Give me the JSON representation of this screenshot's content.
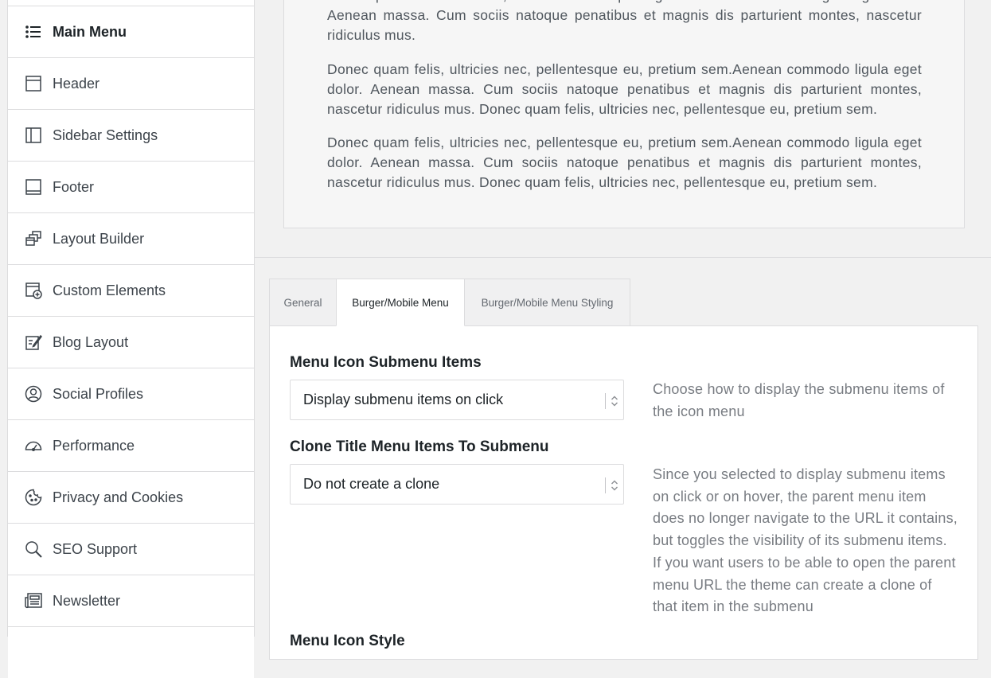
{
  "sidebar": {
    "items": [
      {
        "label": "Main Menu",
        "icon": "list-icon",
        "active": true
      },
      {
        "label": "Header",
        "icon": "header-layout-icon"
      },
      {
        "label": "Sidebar Settings",
        "icon": "sidebar-layout-icon"
      },
      {
        "label": "Footer",
        "icon": "footer-layout-icon"
      },
      {
        "label": "Layout Builder",
        "icon": "layers-icon"
      },
      {
        "label": "Custom Elements",
        "icon": "add-element-icon"
      },
      {
        "label": "Blog Layout",
        "icon": "edit-icon"
      },
      {
        "label": "Social Profiles",
        "icon": "user-circle-icon"
      },
      {
        "label": "Performance",
        "icon": "gauge-icon"
      },
      {
        "label": "Privacy and Cookies",
        "icon": "cookie-icon"
      },
      {
        "label": "SEO Support",
        "icon": "search-icon"
      },
      {
        "label": "Newsletter",
        "icon": "newspaper-icon"
      }
    ]
  },
  "preview": {
    "paragraphs": [
      "Lorem ipsum dolor sit amet, consectetuer adipiscing elit. Aenean commodo ligula eget dolor. Aenean massa. Cum sociis natoque penatibus et magnis dis parturient montes, nascetur ridiculus mus.",
      "Donec quam felis, ultricies nec, pellentesque eu, pretium sem.Aenean commodo ligula eget dolor. Aenean massa. Cum sociis natoque penatibus et magnis dis parturient montes, nascetur ridiculus mus. Donec quam felis, ultricies nec, pellentesque eu, pretium sem.",
      "Donec quam felis, ultricies nec, pellentesque eu, pretium sem.Aenean commodo ligula eget dolor. Aenean massa. Cum sociis natoque penatibus et magnis dis parturient montes, nascetur ridiculus mus. Donec quam felis, ultricies nec, pellentesque eu, pretium sem."
    ]
  },
  "tabs": [
    {
      "label": "General"
    },
    {
      "label": "Burger/Mobile Menu",
      "active": true
    },
    {
      "label": "Burger/Mobile Menu Styling"
    }
  ],
  "settings": {
    "submenu_items": {
      "label": "Menu Icon Submenu Items",
      "value": "Display submenu items on click",
      "help": "Choose how to display the submenu items of the icon menu"
    },
    "clone_title": {
      "label": "Clone Title Menu Items To Submenu",
      "value": "Do not create a clone",
      "help": "Since you selected to display submenu items on click or on hover, the parent menu item does no longer navigate to the URL it contains, but toggles the visibility of its submenu items. If you want users to be able to open the parent menu URL the theme can create a clone of that item in the submenu"
    },
    "next_label": "Menu Icon Style"
  },
  "colors": {
    "background": "#f1f1f1",
    "panel": "#ffffff",
    "border": "#dcdcde",
    "text": "#3c434a",
    "muted": "#787c82"
  }
}
